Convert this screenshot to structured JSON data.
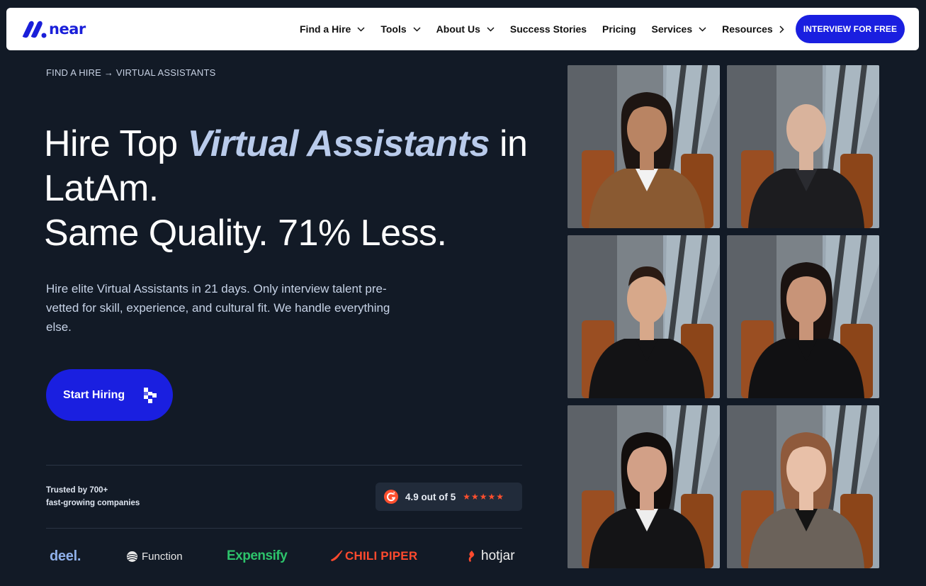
{
  "nav": {
    "logo_text": "near",
    "items": [
      {
        "label": "Find a Hire",
        "chevron": "down"
      },
      {
        "label": "Tools",
        "chevron": "down"
      },
      {
        "label": "About Us",
        "chevron": "down"
      },
      {
        "label": "Success Stories",
        "chevron": ""
      },
      {
        "label": "Pricing",
        "chevron": ""
      },
      {
        "label": "Services",
        "chevron": "down"
      },
      {
        "label": "Resources",
        "chevron": "right"
      }
    ],
    "cta_label": "INTERVIEW FOR FREE"
  },
  "hero": {
    "breadcrumb": "FIND A HIRE → VIRTUAL ASSISTANTS",
    "headline_part1": "Hire Top ",
    "headline_accent": "Virtual Assistants",
    "headline_part2": " in LatAm.",
    "headline_line3": "Same Quality. 71% Less.",
    "subheading": "Hire elite Virtual Assistants in 21 days. Only interview talent pre-vetted for skill, experience, and cultural fit. We handle everything else.",
    "cta_label": "Start Hiring"
  },
  "trust": {
    "line1": "Trusted by 700+",
    "line2": "fast-growing companies",
    "rating_text": "4.9 out of 5",
    "stars": "★★★★★"
  },
  "client_logos": [
    "deel.",
    "Function",
    "Expensify",
    "CHILI PIPER",
    "hotjar"
  ],
  "colors": {
    "background": "#121a26",
    "brand_blue": "#1a1fe0",
    "accent_text": "#b9cbeb",
    "star_color": "#ff4f2e"
  },
  "photos": [
    {
      "person": "woman-brown-vest",
      "top_color": "#8a5a32",
      "shirt_color": "#f2f2f2",
      "skin": "#b98463",
      "hair": "#1d1512"
    },
    {
      "person": "bald-man-black-suit",
      "top_color": "#1c1c1f",
      "shirt_color": "#2a2b30",
      "skin": "#d9b39c",
      "hair": "#d9b39c"
    },
    {
      "person": "man-black-shirt",
      "top_color": "#131315",
      "shirt_color": "#131315",
      "skin": "#d7a88a",
      "hair": "#2a1b14"
    },
    {
      "person": "woman-black-top",
      "top_color": "#111113",
      "shirt_color": "#111113",
      "skin": "#c89478",
      "hair": "#1a1210"
    },
    {
      "person": "woman-leather-jacket",
      "top_color": "#141416",
      "shirt_color": "#eeeeee",
      "skin": "#d2a087",
      "hair": "#120e0d"
    },
    {
      "person": "woman-grey-blazer",
      "top_color": "#6b625a",
      "shirt_color": "#141414",
      "skin": "#e8c0a8",
      "hair": "#8f5a3c"
    }
  ]
}
